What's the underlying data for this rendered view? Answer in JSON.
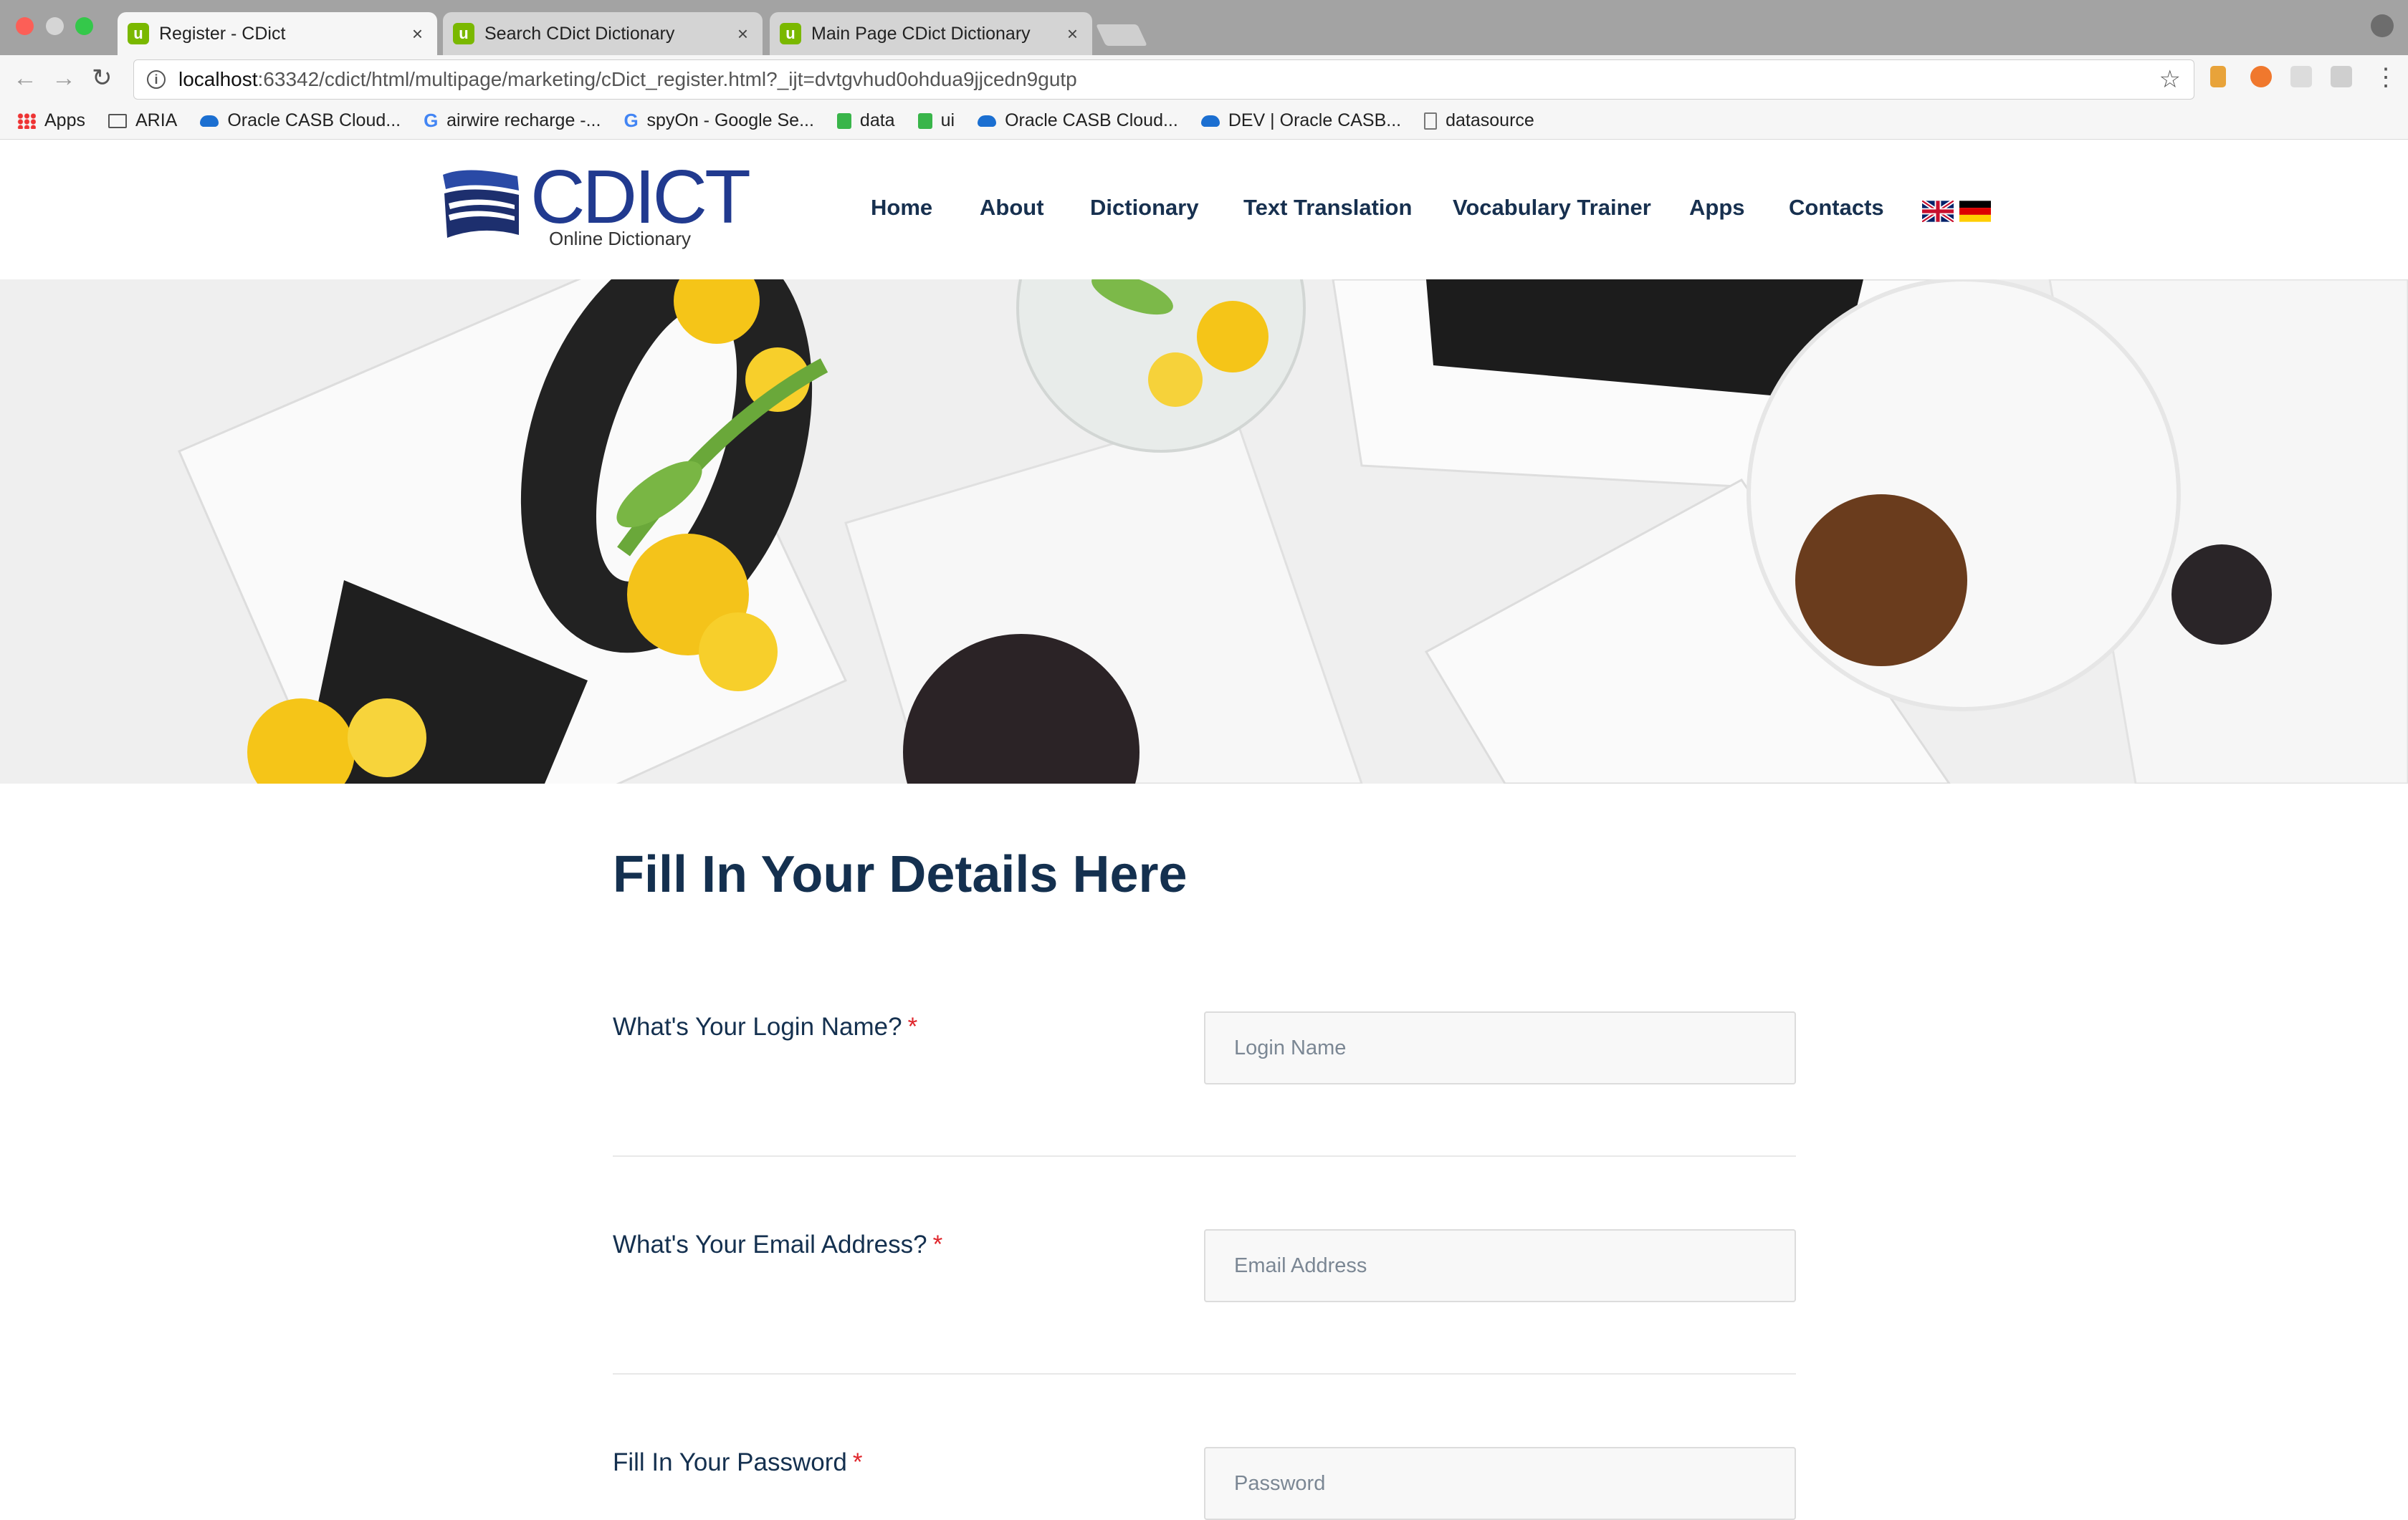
{
  "browser": {
    "tabs": [
      {
        "title": "Register - CDict",
        "active": true
      },
      {
        "title": "Search CDict Dictionary",
        "active": false
      },
      {
        "title": "Main Page CDict Dictionary",
        "active": false
      }
    ],
    "favicon_letter": "u",
    "close_glyph": "×",
    "url_host": "localhost",
    "url_rest": ":63342/cdict/html/multipage/marketing/cDict_register.html?_ijt=dvtgvhud0ohdua9jjcedn9gutp",
    "bookmarks": [
      {
        "label": "Apps",
        "icon": "apps-grid-icon"
      },
      {
        "label": "ARIA",
        "icon": "folder-icon"
      },
      {
        "label": "Oracle CASB Cloud...",
        "icon": "cloud-icon"
      },
      {
        "label": "airwire recharge -...",
        "icon": "google-icon"
      },
      {
        "label": "spyOn - Google Se...",
        "icon": "google-icon"
      },
      {
        "label": "data",
        "icon": "green-bookmark-icon"
      },
      {
        "label": "ui",
        "icon": "green-bookmark-icon"
      },
      {
        "label": "Oracle CASB Cloud...",
        "icon": "cloud-icon"
      },
      {
        "label": "DEV | Oracle CASB...",
        "icon": "cloud-icon"
      },
      {
        "label": "datasource",
        "icon": "document-icon"
      }
    ]
  },
  "site": {
    "logo_text": "CDICT",
    "logo_subtitle": "Online Dictionary",
    "nav": [
      "Home",
      "About",
      "Dictionary",
      "Text Translation",
      "Vocabulary Trainer",
      "Apps",
      "Contacts"
    ],
    "languages": [
      "English",
      "German"
    ]
  },
  "form": {
    "title": "Fill In Your Details Here",
    "required_mark": "*",
    "fields": [
      {
        "label": "What's Your Login Name?",
        "placeholder": "Login Name",
        "value": ""
      },
      {
        "label": "What's Your Email Address?",
        "placeholder": "Email Address",
        "value": ""
      },
      {
        "label": "Fill In Your Password",
        "placeholder": "Password",
        "value": ""
      }
    ]
  },
  "colors": {
    "brand_navy": "#14304f",
    "logo_blue": "#213a8f",
    "required_red": "#e0262c",
    "favicon_green": "#7ab800"
  }
}
